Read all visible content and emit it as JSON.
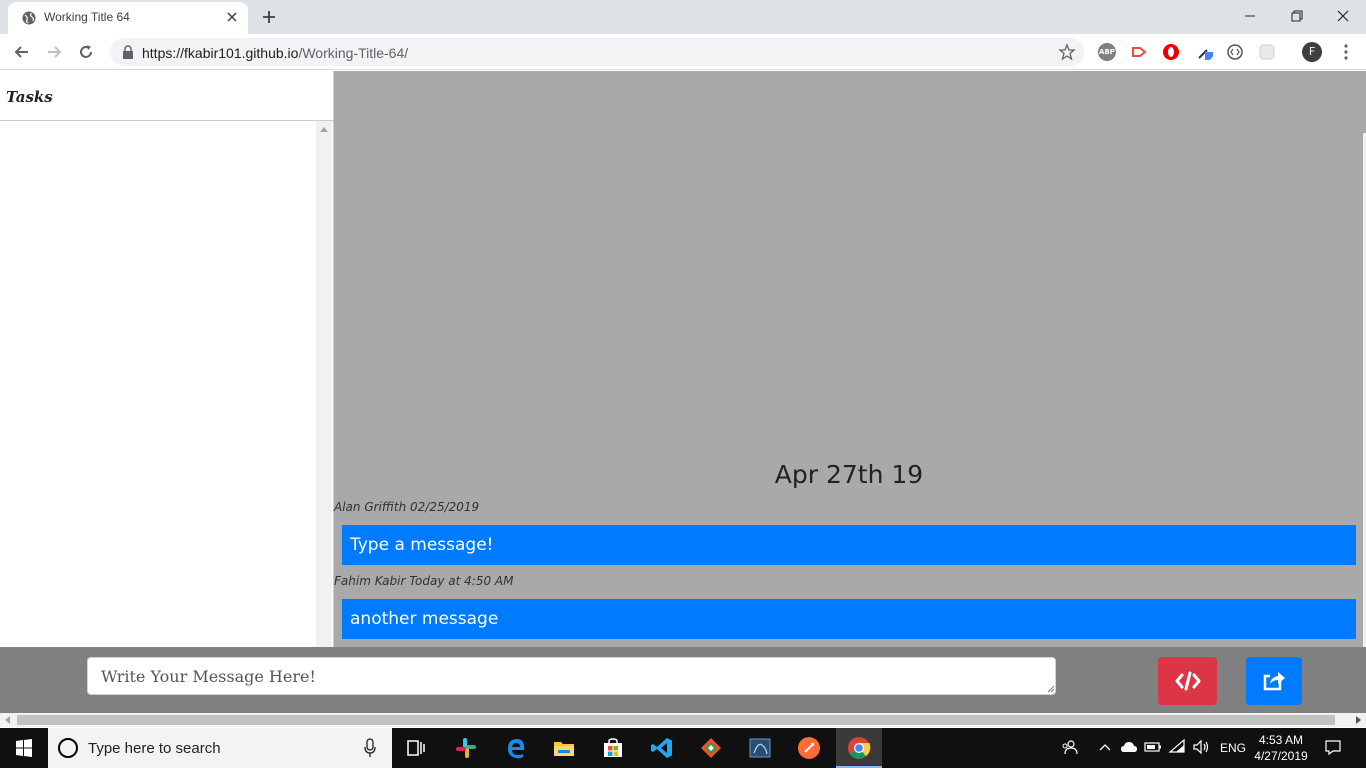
{
  "browser": {
    "tab_title": "Working Title 64",
    "url_host": "https://fkabir101.github.io",
    "url_path": "/Working-Title-64/",
    "profile_initial": "F",
    "ext_abp": "ABP"
  },
  "sidebar": {
    "title": "Tasks"
  },
  "chat": {
    "date_separator": "Apr 27th 19",
    "messages": [
      {
        "meta": "Alan Griffith 02/25/2019",
        "text": "Type a message!"
      },
      {
        "meta": "Fahim Kabir Today at 4:50 AM",
        "text": "another message"
      }
    ]
  },
  "composer": {
    "placeholder": "Write Your Message Here!"
  },
  "taskbar": {
    "search_placeholder": "Type here to search",
    "language": "ENG",
    "time": "4:53 AM",
    "date": "4/27/2019"
  },
  "colors": {
    "accent": "#007bff",
    "danger": "#dc3545",
    "chat_bg": "#a9a9a9",
    "composer_bg": "#808080"
  }
}
